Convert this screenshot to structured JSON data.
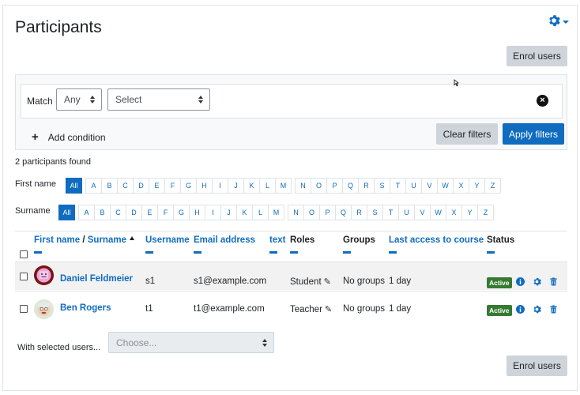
{
  "page": {
    "title": "Participants"
  },
  "actions": {
    "enrol_label": "Enrol users"
  },
  "filters": {
    "match_label": "Match",
    "match_value": "Any",
    "select_value": "Select",
    "add_condition_label": "Add condition",
    "clear_label": "Clear filters",
    "apply_label": "Apply filters"
  },
  "summary": {
    "found_text": "2 participants found"
  },
  "initials": {
    "firstname_label": "First name",
    "surname_label": "Surname",
    "all_label": "All",
    "letters": [
      "A",
      "B",
      "C",
      "D",
      "E",
      "F",
      "G",
      "H",
      "I",
      "J",
      "K",
      "L",
      "M",
      "N",
      "O",
      "P",
      "Q",
      "R",
      "S",
      "T",
      "U",
      "V",
      "W",
      "X",
      "Y",
      "Z"
    ]
  },
  "table": {
    "headers": {
      "firstname": "First name",
      "separator": " / ",
      "surname": "Surname",
      "username": "Username",
      "email": "Email address",
      "text": "text",
      "roles": "Roles",
      "groups": "Groups",
      "last_access": "Last access to course",
      "status": "Status"
    },
    "rows": [
      {
        "name": "Daniel Feldmeier",
        "username": "s1",
        "email": "s1@example.com",
        "role": "Student",
        "groups": "No groups",
        "last_access": "1 day",
        "status": "Active"
      },
      {
        "name": "Ben Rogers",
        "username": "t1",
        "email": "t1@example.com",
        "role": "Teacher",
        "groups": "No groups",
        "last_access": "1 day",
        "status": "Active"
      }
    ]
  },
  "bulk": {
    "label": "With selected users...",
    "placeholder": "Choose..."
  },
  "colors": {
    "primary": "#0f6cbf",
    "active_badge": "#357a32",
    "secondary_button": "#ced4da"
  },
  "icons": [
    "cog-icon",
    "close-circle-icon",
    "plus-icon",
    "sort-asc-icon",
    "pencil-icon",
    "info-icon",
    "settings-icon",
    "trash-icon"
  ]
}
